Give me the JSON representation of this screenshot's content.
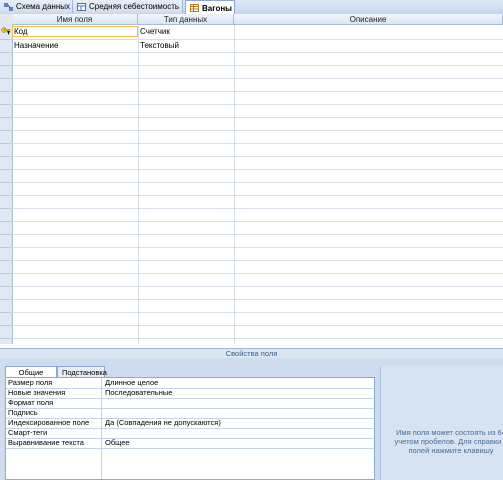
{
  "tabs": [
    {
      "label": "Схема данных",
      "icon": "relationships-icon"
    },
    {
      "label": "Средняя себестоимость",
      "icon": "query-icon"
    },
    {
      "label": "Вагоны",
      "icon": "table-icon",
      "active": true
    }
  ],
  "grid": {
    "columns": [
      "Имя поля",
      "Тип данных",
      "Описание"
    ],
    "rows": [
      {
        "name": "Код",
        "type": "Счетчик",
        "description": "",
        "primary_key": true
      },
      {
        "name": "Назначение",
        "type": "Текстовый",
        "description": ""
      }
    ]
  },
  "properties": {
    "title": "Свойства поля",
    "tabs": [
      "Общие",
      "Подстановка"
    ],
    "rows": [
      {
        "label": "Размер поля",
        "value": "Длинное целое"
      },
      {
        "label": "Новые значения",
        "value": "Последовательные"
      },
      {
        "label": "Формат поля",
        "value": ""
      },
      {
        "label": "Подпись",
        "value": ""
      },
      {
        "label": "Индексированное поле",
        "value": "Да (Совпадения не допускаются)"
      },
      {
        "label": "Смарт-теги",
        "value": ""
      },
      {
        "label": "Выравнивание текста",
        "value": "Общее"
      }
    ],
    "hint_lines": [
      "Имя поля может состоять из 64",
      "учетом пробелов.  Для справки п",
      "полей нажмите клавишу"
    ]
  },
  "colors": {
    "accent": "#f0c040",
    "header_bg": "#dbe5f2",
    "panel_bg": "#cfdcef"
  }
}
